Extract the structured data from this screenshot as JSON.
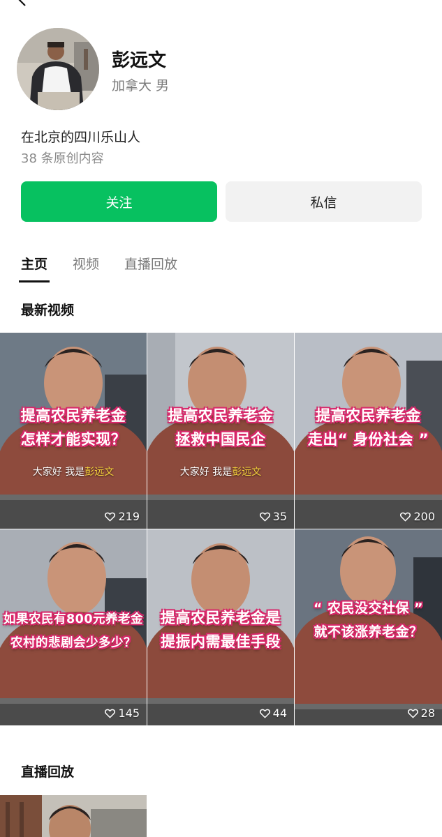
{
  "profile": {
    "name": "彭远文",
    "location_gender": "加拿大 男",
    "bio": "在北京的四川乐山人",
    "original_count": "38 条原创内容"
  },
  "actions": {
    "follow": "关注",
    "message": "私信"
  },
  "tabs": [
    {
      "label": "主页",
      "active": true
    },
    {
      "label": "视频",
      "active": false
    },
    {
      "label": "直播回放",
      "active": false
    }
  ],
  "sections": {
    "latest_videos": "最新视频",
    "live_replay": "直播回放"
  },
  "videos": [
    {
      "caption_lines": [
        "提高农民养老金",
        "怎样才能实现？"
      ],
      "subtitle_prefix": "大家好 我是",
      "subtitle_name": "彭远文",
      "likes": "219"
    },
    {
      "caption_lines": [
        "提高农民养老金",
        "拯救中国民企"
      ],
      "subtitle_prefix": "大家好 我是",
      "subtitle_name": "彭远文",
      "likes": "35"
    },
    {
      "caption_lines": [
        "提高农民养老金",
        "走出“ 身份社会 ”"
      ],
      "likes": "200"
    },
    {
      "caption_lines": [
        "如果农民有800元养老金",
        "农村的悲剧会少多少？"
      ],
      "likes": "145"
    },
    {
      "caption_lines": [
        "提高农民养老金是",
        "提振内需最佳手段"
      ],
      "likes": "44"
    },
    {
      "caption_lines": [
        "“ 农民没交社保 ”",
        "就不该涨养老金？"
      ],
      "likes": "28"
    }
  ],
  "colors": {
    "follow_button": "#07c160",
    "message_button": "#f2f2f2",
    "caption_stroke": "#d6266b",
    "subtitle_highlight": "#f7d23c"
  }
}
